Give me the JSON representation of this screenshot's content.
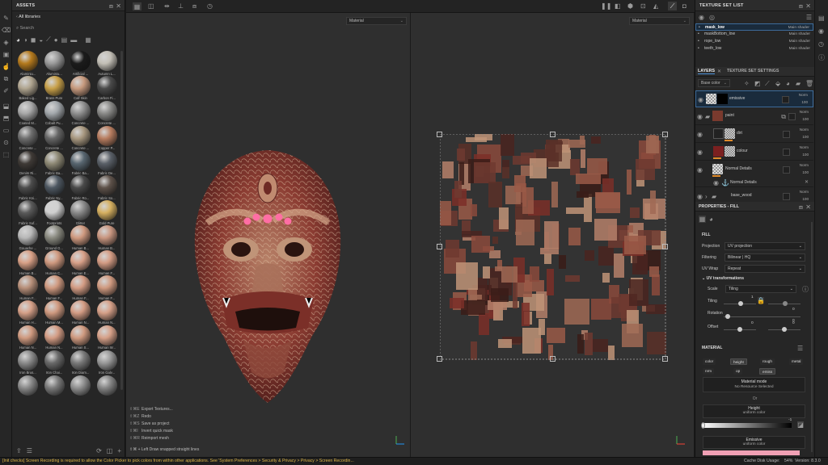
{
  "assets": {
    "title": "ASSETS",
    "breadcrumb": "All libraries",
    "search_placeholder": "Search",
    "tiles": [
      {
        "label": "Aluminiu...",
        "color": "#b57a1d"
      },
      {
        "label": "Aluminiu...",
        "color": "#9a9a9a"
      },
      {
        "label": "Artificial ...",
        "color": "#1b1b1b"
      },
      {
        "label": "Autumn L...",
        "color": "#c3bfb6"
      },
      {
        "label": "Baked Lig...",
        "color": "#b0a590"
      },
      {
        "label": "Brass Pure",
        "color": "#c8a048"
      },
      {
        "label": "Calf Skin",
        "color": "#c79a7e"
      },
      {
        "label": "Carbon Fi...",
        "color": "#4a4a4a"
      },
      {
        "label": "Coated M...",
        "color": "#a8a8a8"
      },
      {
        "label": "Cobalt Pu...",
        "color": "#a3a8ac"
      },
      {
        "label": "Concrete ...",
        "color": "#909090"
      },
      {
        "label": "Concrete ...",
        "color": "#8a8a88"
      },
      {
        "label": "Concrete ...",
        "color": "#6e6e6e"
      },
      {
        "label": "Concrete ...",
        "color": "#666666"
      },
      {
        "label": "Concrete ...",
        "color": "#a89880"
      },
      {
        "label": "Copper P...",
        "color": "#b87d60"
      },
      {
        "label": "Denim Ri...",
        "color": "#3f3a36"
      },
      {
        "label": "Fabric Ba...",
        "color": "#8f8a76"
      },
      {
        "label": "Fabric Ba...",
        "color": "#586670"
      },
      {
        "label": "Fabric De...",
        "color": "#5a6068"
      },
      {
        "label": "Fabric Kni...",
        "color": "#4c4c4c"
      },
      {
        "label": "Fabric Ny...",
        "color": "#4e5862"
      },
      {
        "label": "Fabric Ro...",
        "color": "#4a4a4a"
      },
      {
        "label": "Fabric So...",
        "color": "#5e524a"
      },
      {
        "label": "Fabric Suf...",
        "color": "#5a5a5a"
      },
      {
        "label": "Footprints",
        "color": "#d0d0d0"
      },
      {
        "label": "Glitter",
        "color": "#8a8a8a"
      },
      {
        "label": "Gold Pure",
        "color": "#d6b060"
      },
      {
        "label": "Gouache ...",
        "color": "#b8b8b8"
      },
      {
        "label": "Ground G...",
        "color": "#8a8a80"
      },
      {
        "label": "Human B...",
        "color": "#d09a80"
      },
      {
        "label": "Human B...",
        "color": "#c99680"
      },
      {
        "label": "Human B...",
        "color": "#d8a086"
      },
      {
        "label": "Human C...",
        "color": "#d09a80"
      },
      {
        "label": "Human E...",
        "color": "#d8a088"
      },
      {
        "label": "Human F...",
        "color": "#d49c84"
      },
      {
        "label": "Human F...",
        "color": "#b8907a"
      },
      {
        "label": "Human F...",
        "color": "#d09a80"
      },
      {
        "label": "Human F...",
        "color": "#d49c84"
      },
      {
        "label": "Human F...",
        "color": "#d09a80"
      },
      {
        "label": "Human H...",
        "color": "#d6a088"
      },
      {
        "label": "Human M...",
        "color": "#d09a80"
      },
      {
        "label": "Human N...",
        "color": "#d49c84"
      },
      {
        "label": "Human N...",
        "color": "#d6a088"
      },
      {
        "label": "Human N...",
        "color": "#d09a80"
      },
      {
        "label": "Human N...",
        "color": "#d49c84"
      },
      {
        "label": "Human S...",
        "color": "#d09a80"
      },
      {
        "label": "Human W...",
        "color": "#d6a088"
      },
      {
        "label": "Iron Brus...",
        "color": "#8c8c8c"
      },
      {
        "label": "Iron Chai...",
        "color": "#6a6a6a"
      },
      {
        "label": "Iron Diam...",
        "color": "#7a7a7a"
      },
      {
        "label": "Iron Galv...",
        "color": "#9a9a9a"
      },
      {
        "label": "",
        "color": "#8a8a8a"
      },
      {
        "label": "",
        "color": "#7a7a7a"
      },
      {
        "label": "",
        "color": "#909090"
      },
      {
        "label": "",
        "color": "#858585"
      }
    ]
  },
  "viewport": {
    "left_dropdown": "Material",
    "right_dropdown": "Material",
    "shortcuts": [
      {
        "key": "⇧⌘E",
        "action": "Export Textures..."
      },
      {
        "key": "⇧⌘Z",
        "action": "Redo"
      },
      {
        "key": "⇧⌘S",
        "action": "Save as project"
      },
      {
        "key": "⇧⌘I",
        "action": "Invert quick mask"
      },
      {
        "key": "⇧⌘R",
        "action": "Reimport mesh"
      }
    ],
    "hint_key": "⇧⌘ + Left",
    "hint_action": "Draw snapped straight lines"
  },
  "texture_set_list": {
    "title": "TEXTURE SET LIST",
    "rows": [
      {
        "name": "mask_low",
        "shader": "Main shader"
      },
      {
        "name": "maskBottom_low",
        "shader": "Main shader"
      },
      {
        "name": "rope_low",
        "shader": "Main shader"
      },
      {
        "name": "teeth_low",
        "shader": "Main shader"
      }
    ]
  },
  "layers": {
    "tab_layers": "LAYERS",
    "tab_settings": "TEXTURE SET SETTINGS",
    "channel_select": "Base color",
    "items": [
      {
        "name": "emissive",
        "blend": "Norm",
        "opacity": "100"
      },
      {
        "name": "paint",
        "blend": "Norm",
        "opacity": "100"
      },
      {
        "name": "dirt",
        "blend": "Norm",
        "opacity": "100"
      },
      {
        "name": "colour",
        "blend": "Norm",
        "opacity": "100"
      },
      {
        "name": "Normal Details",
        "blend": "Norm",
        "opacity": "100"
      },
      {
        "name": "base_wood",
        "blend": "Norm",
        "opacity": "100"
      }
    ],
    "sub_normal": "Normal Details"
  },
  "properties": {
    "title": "PROPERTIES - FILL",
    "fill_heading": "FILL",
    "projection_label": "Projection",
    "projection_value": "UV projection",
    "filtering_label": "Filtering",
    "filtering_value": "Bilinear | HQ",
    "uvwrap_label": "UV Wrap",
    "uvwrap_value": "Repeat",
    "uv_heading": "UV transformations",
    "scale_label": "Scale",
    "scale_value": "Tiling",
    "tiling_label": "Tiling",
    "tiling_value": "1",
    "rotation_label": "Rotation",
    "rotation_value": "0",
    "offset_label": "Offset",
    "offset_value1": "0",
    "offset_value2": "0",
    "tiling_right": "0",
    "material_heading": "MATERIAL",
    "channels": [
      "color",
      "height",
      "rough",
      "metal",
      "nrm",
      "op",
      "emiss"
    ],
    "material_mode_title": "Material mode",
    "material_mode_sub": "No Resource Selected",
    "or_text": "Or",
    "height_title": "Height",
    "height_sub": "uniform color",
    "height_value": "-1",
    "emissive_title": "Emissive",
    "emissive_sub": "uniform color",
    "emissive_color": "#f0a0b4"
  },
  "status": {
    "message": "[Init checks] Screen Recording is required to allow the Color Picker to pick colors from within other applications. See 'System Preferences > Security & Privacy > Privacy > Screen Recordin...",
    "cache": "Cache Disk Usage:",
    "cache_value": "54%",
    "version": "Version: 8.3.0"
  }
}
